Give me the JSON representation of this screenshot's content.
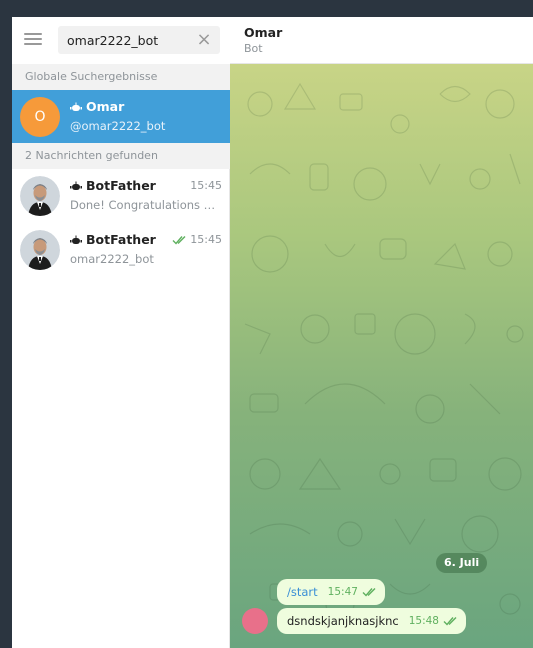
{
  "search": {
    "value": "omar2222_bot",
    "clear_glyph": "×"
  },
  "sections": {
    "global": "Globale Suchergebnisse",
    "messages": "2 Nachrichten gefunden"
  },
  "results": [
    {
      "avatar_letter": "O",
      "name": "Omar",
      "sub": "@omar2222_bot",
      "icon": "bot-icon"
    }
  ],
  "messages_found": [
    {
      "name": "BotFather",
      "sub": "Done! Congratulations on your new bot.",
      "time": "15:45",
      "read": false,
      "icon": "bot-icon"
    },
    {
      "name": "BotFather",
      "sub": "omar2222_bot",
      "time": "15:45",
      "read": true,
      "icon": "bot-icon"
    }
  ],
  "chat": {
    "title": "Omar",
    "subtitle": "Bot",
    "date": "6. Juli",
    "messages": [
      {
        "text": "/start",
        "time": "15:47"
      },
      {
        "text": "dsndskjanjknasjknc",
        "time": "15:48"
      }
    ]
  },
  "colors": {
    "selected": "#419fd9",
    "avatar_omar": "#f69a3a",
    "bubble": "#effdde",
    "check": "#5fb05f",
    "sender_avatar": "#e8708a"
  }
}
